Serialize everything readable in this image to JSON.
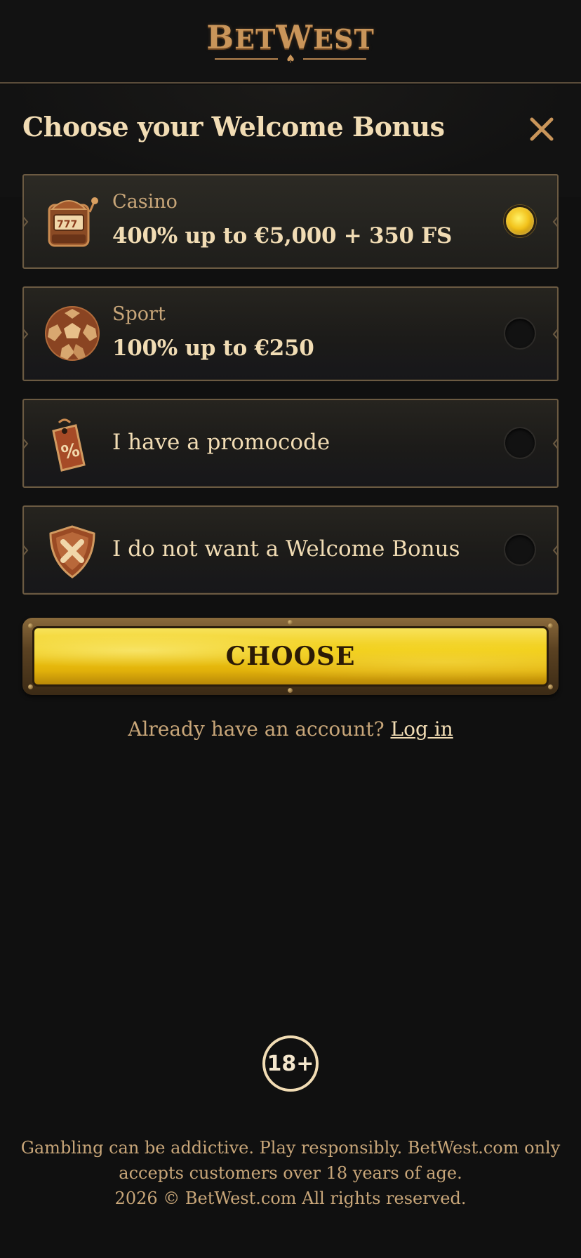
{
  "header": {
    "logo_text_big": "B",
    "logo_text_mid": "ET",
    "logo_text_big2": "W",
    "logo_text_end": "EST"
  },
  "modal": {
    "title": "Choose your Welcome Bonus",
    "close_icon": "close-icon"
  },
  "options": [
    {
      "category": "Casino",
      "offer": "400% up to €5,000 + 350 FS",
      "icon": "slot-machine-icon",
      "selected": true
    },
    {
      "category": "Sport",
      "offer": "100% up to €250",
      "icon": "soccer-ball-icon",
      "selected": false
    },
    {
      "label": "I have a promocode",
      "icon": "price-tag-icon",
      "selected": false
    },
    {
      "label": "I do not want a Welcome Bonus",
      "icon": "shield-cross-icon",
      "selected": false
    }
  ],
  "choose_button": {
    "label": "CHOOSE"
  },
  "login": {
    "prompt": "Already have an account?",
    "link": "Log in"
  },
  "footer": {
    "age_badge": "18+",
    "disclaimer_line1": "Gambling can be addictive. Play responsibly. BetWest.com only accepts customers over 18 years of age.",
    "copyright": "2026 © BetWest.com All rights reserved."
  },
  "colors": {
    "background": "#101010",
    "accent_gold": "#c9955a",
    "text_cream": "#f1dcb4",
    "button_yellow": "#f1cd14"
  }
}
